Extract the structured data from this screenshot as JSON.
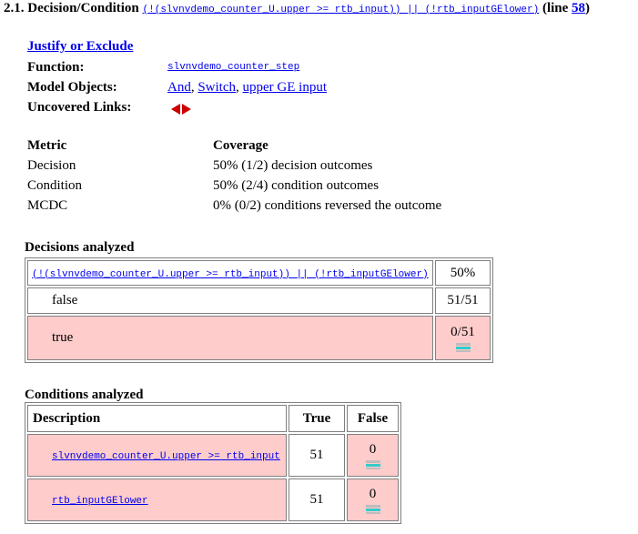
{
  "heading": {
    "prefix": "2.1. Decision/Condition",
    "expression": "(!(slvnvdemo_counter_U.upper >= rtb_input)) || (!rtb_inputGElower)",
    "line_prefix": "(line",
    "line_number": "58",
    "line_suffix": ")"
  },
  "details": {
    "justify_label": "Justify or Exclude",
    "function_label": "Function:",
    "function_value": "slvnvdemo_counter_step",
    "model_objects_label": "Model Objects:",
    "model_objects": [
      "And",
      "Switch",
      "upper GE input"
    ],
    "uncovered_links_label": "Uncovered Links:"
  },
  "metrics": {
    "header": [
      "Metric",
      "Coverage"
    ],
    "rows": [
      [
        "Decision",
        "50% (1/2) decision outcomes"
      ],
      [
        "Condition",
        "50% (2/4) condition outcomes"
      ],
      [
        "MCDC",
        "0% (0/2) conditions reversed the outcome"
      ]
    ]
  },
  "decisions": {
    "title": "Decisions analyzed",
    "expression": "(!(slvnvdemo_counter_U.upper >= rtb_input)) || (!rtb_inputGElower)",
    "percent": "50%",
    "rows": [
      {
        "outcome": "false",
        "count": "51/51"
      },
      {
        "outcome": "true",
        "count": "0/51"
      }
    ]
  },
  "conditions": {
    "title": "Conditions analyzed",
    "header": [
      "Description",
      "True",
      "False"
    ],
    "rows": [
      {
        "description": "slvnvdemo_counter_U.upper >= rtb_input",
        "true": "51",
        "false": "0"
      },
      {
        "description": "rtb_inputGElower",
        "true": "51",
        "false": "0"
      }
    ]
  },
  "colors": {
    "link": "#0000ee",
    "uncovered_bg": "#ffcccc",
    "arrow": "#cc0000"
  }
}
